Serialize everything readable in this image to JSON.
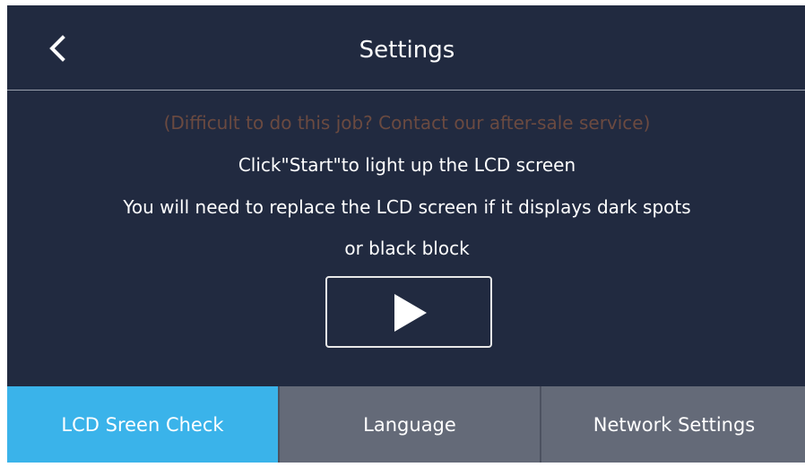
{
  "header": {
    "back_icon": "chevron-left-icon",
    "title": "Settings"
  },
  "main": {
    "notice": "(Difficult to do this job? Contact our after-sale service)",
    "instruction_start": "Click\"Start\"to light up the LCD screen",
    "instruction_replace_line1": "You will need to replace the LCD screen if it displays dark spots",
    "instruction_replace_line2": "or black block",
    "start_icon": "play-icon"
  },
  "tabs": [
    {
      "label": "LCD Sreen Check",
      "active": true
    },
    {
      "label": "Language",
      "active": false
    },
    {
      "label": "Network Settings",
      "active": false
    }
  ],
  "colors": {
    "background": "#212a40",
    "notice_text": "#6b4a40",
    "tab_active": "#3ab3ea",
    "tab_inactive": "#646a78"
  }
}
